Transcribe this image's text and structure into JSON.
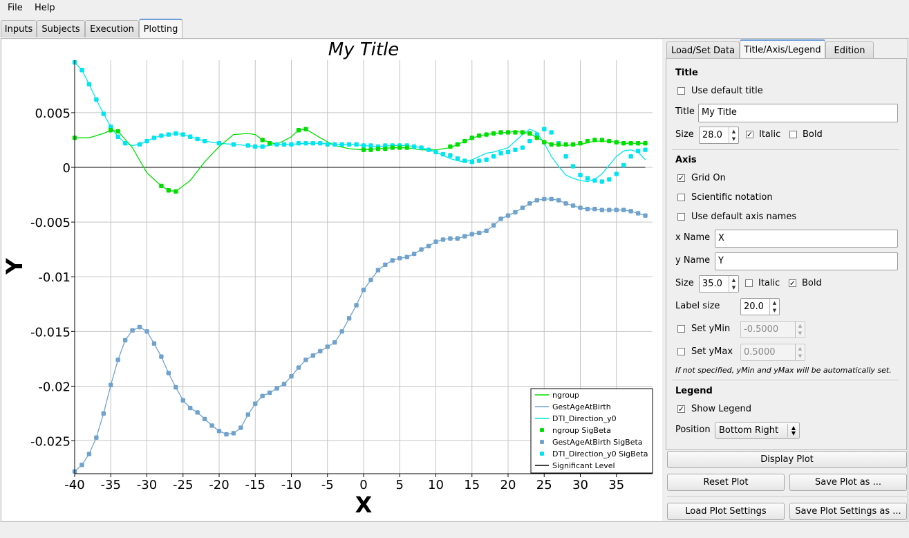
{
  "menu": {
    "file": "File",
    "help": "Help"
  },
  "main_tabs": [
    "Inputs",
    "Subjects",
    "Execution",
    "Plotting"
  ],
  "active_main_tab": "Plotting",
  "right_tabs": [
    "Load/Set Data",
    "Title/Axis/Legend",
    "Edition"
  ],
  "active_right_tab": "Title/Axis/Legend",
  "panel": {
    "title_section": "Title",
    "use_default_title": "Use default title",
    "use_default_title_checked": false,
    "title_label": "Title",
    "title_value": "My Title",
    "size_label": "Size",
    "title_size": "28.0",
    "italic_label": "Italic",
    "title_italic": true,
    "bold_label": "Bold",
    "title_bold": false,
    "axis_section": "Axis",
    "grid_on": "Grid On",
    "grid_on_checked": true,
    "scientific": "Scientific notation",
    "scientific_checked": false,
    "default_axis_names": "Use default axis names",
    "default_axis_names_checked": false,
    "x_name_label": "x Name",
    "x_name": "X",
    "y_name_label": "y Name",
    "y_name": "Y",
    "axis_size": "35.0",
    "axis_italic": false,
    "axis_bold": true,
    "label_size_label": "Label size",
    "label_size": "20.0",
    "set_ymin": "Set yMin",
    "ymin": "-0.5000",
    "set_ymax": "Set yMax",
    "ymax": "0.5000",
    "note": "If not specified, yMin and yMax will be automatically set.",
    "legend_section": "Legend",
    "show_legend": "Show Legend",
    "show_legend_checked": true,
    "position_label": "Position",
    "position_value": "Bottom Right"
  },
  "buttons": {
    "display_plot": "Display Plot",
    "reset_plot": "Reset Plot",
    "save_plot": "Save Plot as ...",
    "load_settings": "Load Plot Settings",
    "save_settings": "Save Plot Settings as ..."
  },
  "icons": {
    "check": "check-icon",
    "updown": "up-down-arrows-icon",
    "spin": "spin-arrows-icon"
  },
  "chart_data": {
    "type": "line",
    "title": "My Title",
    "xlabel": "X",
    "ylabel": "Y",
    "xlim": [
      -40,
      40
    ],
    "ylim": [
      -0.028,
      0.0098
    ],
    "x_ticks": [
      -40,
      -35,
      -30,
      -25,
      -20,
      -15,
      -10,
      -5,
      0,
      5,
      10,
      15,
      20,
      25,
      30,
      35
    ],
    "y_ticks": [
      0.005,
      0,
      -0.005,
      -0.01,
      -0.015,
      -0.02,
      -0.025
    ],
    "y_tick_labels": [
      "0.005",
      "0",
      "-0.005",
      "-0.01",
      "-0.015",
      "-0.02",
      "-0.025"
    ],
    "grid": true,
    "legend_position": "bottom-right",
    "colors": {
      "ngroup": "#00e000",
      "gest": "#6fa2cc",
      "dti": "#00e5f0",
      "sig": "#000000"
    },
    "significant_level": 0,
    "legend": [
      "ngroup",
      "GestAgeAtBirth",
      "DTI_Direction_y0",
      "ngroup SigBeta",
      "GestAgeAtBirth SigBeta",
      "DTI_Direction_y0 SigBeta",
      "Significant Level"
    ],
    "series": [
      {
        "name": "ngroup",
        "x": [
          -40,
          -38,
          -36,
          -35,
          -34,
          -32,
          -30,
          -28,
          -27,
          -26,
          -24,
          -22,
          -20,
          -18,
          -16,
          -15,
          -14,
          -12,
          -10,
          -9,
          -8,
          -6,
          -4,
          -2,
          0,
          2,
          4,
          6,
          8,
          10,
          12,
          14,
          16,
          18,
          20,
          21,
          22,
          23,
          24,
          26,
          28,
          30,
          32,
          34,
          36,
          39
        ],
        "y": [
          0.0027,
          0.0027,
          0.0031,
          0.0034,
          0.0033,
          0.0018,
          -0.0005,
          -0.0017,
          -0.0021,
          -0.0022,
          -0.0012,
          0.0005,
          0.0019,
          0.003,
          0.0031,
          0.003,
          0.0025,
          0.0021,
          0.0028,
          0.0034,
          0.0035,
          0.0027,
          0.002,
          0.0017,
          0.0016,
          0.0017,
          0.0018,
          0.0018,
          0.0016,
          0.0016,
          0.0018,
          0.0024,
          0.0029,
          0.0031,
          0.0032,
          0.0033,
          0.0032,
          0.0031,
          0.0027,
          0.0021,
          0.002,
          0.0021,
          0.0024,
          0.0024,
          0.0022,
          0.0022
        ]
      },
      {
        "name": "GestAgeAtBirth",
        "x": [
          -40,
          -39,
          -38,
          -37,
          -36,
          -35,
          -34,
          -33,
          -32,
          -31,
          -30,
          -29,
          -28,
          -27,
          -26,
          -25,
          -24,
          -23,
          -22,
          -21,
          -20,
          -19,
          -18,
          -17,
          -16,
          -15,
          -14,
          -13,
          -12,
          -11,
          -10,
          -9,
          -8,
          -7,
          -6,
          -5,
          -4,
          -3,
          -2,
          -1,
          0,
          1,
          2,
          3,
          4,
          5,
          6,
          7,
          8,
          9,
          10,
          11,
          12,
          13,
          14,
          15,
          16,
          17,
          18,
          19,
          20,
          21,
          22,
          23,
          24,
          25,
          26,
          27,
          28,
          29,
          30,
          31,
          32,
          33,
          34,
          35,
          36,
          37,
          38,
          39
        ],
        "y": [
          -0.0278,
          -0.0272,
          -0.0262,
          -0.0247,
          -0.0225,
          -0.0199,
          -0.0176,
          -0.0158,
          -0.0149,
          -0.0146,
          -0.015,
          -0.0161,
          -0.0173,
          -0.0188,
          -0.0201,
          -0.0213,
          -0.022,
          -0.0224,
          -0.023,
          -0.0236,
          -0.0241,
          -0.0244,
          -0.0243,
          -0.0238,
          -0.0226,
          -0.0216,
          -0.0209,
          -0.0206,
          -0.0202,
          -0.0198,
          -0.0191,
          -0.0183,
          -0.0176,
          -0.0172,
          -0.0168,
          -0.0164,
          -0.016,
          -0.015,
          -0.0138,
          -0.0126,
          -0.0112,
          -0.0103,
          -0.0094,
          -0.0089,
          -0.0085,
          -0.0083,
          -0.0082,
          -0.0079,
          -0.0075,
          -0.0072,
          -0.0068,
          -0.0066,
          -0.0065,
          -0.0065,
          -0.0063,
          -0.0061,
          -0.006,
          -0.0058,
          -0.0053,
          -0.0047,
          -0.0044,
          -0.0041,
          -0.0037,
          -0.0033,
          -0.003,
          -0.0029,
          -0.0029,
          -0.003,
          -0.0033,
          -0.0035,
          -0.0037,
          -0.0038,
          -0.0038,
          -0.0039,
          -0.0039,
          -0.0039,
          -0.0039,
          -0.004,
          -0.0042,
          -0.0044
        ]
      },
      {
        "name": "DTI_Direction_y0",
        "x": [
          -40,
          -39,
          -38,
          -37,
          -36,
          -35,
          -34,
          -33,
          -32,
          -31,
          -30,
          -29,
          -28,
          -27,
          -26,
          -25,
          -24,
          -23,
          -22,
          -20,
          -18,
          -16,
          -15,
          -14,
          -12,
          -10,
          -8,
          -6,
          -4,
          -2,
          0,
          2,
          4,
          6,
          8,
          10,
          11,
          12,
          13,
          14,
          15,
          16,
          17,
          18,
          19,
          20,
          21,
          22,
          23,
          24,
          25,
          26,
          27,
          28,
          29,
          30,
          31,
          32,
          33,
          34,
          35,
          36,
          37,
          38,
          39
        ],
        "y": [
          0.0096,
          0.0089,
          0.0076,
          0.0062,
          0.0049,
          0.0037,
          0.0028,
          0.0022,
          0.002,
          0.0021,
          0.0024,
          0.0027,
          0.0029,
          0.003,
          0.0031,
          0.003,
          0.0028,
          0.0026,
          0.0024,
          0.0022,
          0.0021,
          0.002,
          0.0019,
          0.0019,
          0.0021,
          0.0021,
          0.0022,
          0.0022,
          0.0021,
          0.0021,
          0.002,
          0.0019,
          0.002,
          0.002,
          0.0018,
          0.0014,
          0.0011,
          0.0008,
          0.0006,
          0.0005,
          0.0007,
          0.001,
          0.0013,
          0.0014,
          0.0016,
          0.0018,
          0.0024,
          0.003,
          0.0035,
          0.0032,
          0.0022,
          0.001,
          0.0001,
          -0.0007,
          -0.001,
          -0.0012,
          -0.0013,
          -0.0011,
          -0.0006,
          0.0002,
          0.001,
          0.0015,
          0.0016,
          0.0014,
          0.0007
        ]
      },
      {
        "name": "Significant Level",
        "x": [
          -40,
          39
        ],
        "y": [
          0,
          0
        ]
      }
    ],
    "sig_points": {
      "ngroup": {
        "x": [
          -40,
          -35,
          -34,
          -28,
          -27,
          -26,
          -14,
          -13,
          -9,
          -8,
          0,
          1,
          2,
          3,
          4,
          5,
          6,
          12,
          13,
          14,
          15,
          16,
          17,
          18,
          19,
          20,
          21,
          22,
          23,
          24,
          25,
          26,
          27,
          28,
          29,
          30,
          31,
          32,
          33,
          34,
          35,
          36,
          37,
          38,
          39
        ],
        "y": [
          0.0027,
          0.0034,
          0.0033,
          -0.0017,
          -0.0021,
          -0.0022,
          0.0025,
          0.0022,
          0.0034,
          0.0035,
          0.0016,
          0.0016,
          0.0017,
          0.0017,
          0.0018,
          0.0018,
          0.0018,
          0.0019,
          0.0021,
          0.0024,
          0.0027,
          0.0029,
          0.003,
          0.0031,
          0.0032,
          0.0032,
          0.0032,
          0.0032,
          0.0031,
          0.0027,
          0.0023,
          0.0021,
          0.0021,
          0.0021,
          0.0021,
          0.0022,
          0.0024,
          0.0025,
          0.0025,
          0.0024,
          0.0023,
          0.0022,
          0.0022,
          0.0022,
          0.0022
        ]
      },
      "gest": {
        "x": [
          -40,
          -39,
          -38,
          -37,
          -36,
          -35,
          -34,
          -33,
          -32,
          -31,
          -30,
          -29,
          -28,
          -27,
          -26,
          -25,
          -24,
          -23,
          -22,
          -21,
          -20,
          -19,
          -18,
          -17,
          -16,
          -15,
          -14,
          -13,
          -12,
          -11,
          -10,
          -9,
          -8,
          -7,
          -6,
          -5,
          -4,
          -3,
          -2,
          -1,
          0,
          1,
          2,
          3,
          4,
          5,
          6,
          7,
          8,
          9,
          10,
          11,
          12,
          13,
          14,
          15,
          16,
          17,
          18,
          19,
          20,
          21,
          22,
          23,
          24,
          25,
          26,
          27,
          28,
          29,
          30,
          31,
          32,
          33,
          34,
          35,
          36,
          37,
          38,
          39
        ],
        "y": [
          -0.0278,
          -0.0272,
          -0.0262,
          -0.0247,
          -0.0225,
          -0.0199,
          -0.0176,
          -0.0158,
          -0.0149,
          -0.0146,
          -0.015,
          -0.0161,
          -0.0173,
          -0.0188,
          -0.0201,
          -0.0213,
          -0.022,
          -0.0224,
          -0.023,
          -0.0236,
          -0.0241,
          -0.0244,
          -0.0243,
          -0.0238,
          -0.0226,
          -0.0216,
          -0.0209,
          -0.0206,
          -0.0202,
          -0.0198,
          -0.0191,
          -0.0183,
          -0.0176,
          -0.0172,
          -0.0168,
          -0.0164,
          -0.016,
          -0.015,
          -0.0138,
          -0.0126,
          -0.0112,
          -0.0103,
          -0.0094,
          -0.0089,
          -0.0085,
          -0.0083,
          -0.0082,
          -0.0079,
          -0.0075,
          -0.0072,
          -0.0068,
          -0.0066,
          -0.0065,
          -0.0065,
          -0.0063,
          -0.0061,
          -0.006,
          -0.0058,
          -0.0053,
          -0.0047,
          -0.0044,
          -0.0041,
          -0.0037,
          -0.0033,
          -0.003,
          -0.0029,
          -0.0029,
          -0.003,
          -0.0033,
          -0.0035,
          -0.0037,
          -0.0038,
          -0.0038,
          -0.0039,
          -0.0039,
          -0.0039,
          -0.0039,
          -0.004,
          -0.0042,
          -0.0044
        ]
      },
      "dti": {
        "x": [
          -40,
          -39,
          -38,
          -37,
          -36,
          -35,
          -34,
          -33,
          -31,
          -30,
          -29,
          -28,
          -27,
          -26,
          -25,
          -24,
          -23,
          -22,
          -20,
          -18,
          -16,
          -15,
          -14,
          -12,
          -11,
          -10,
          -9,
          -8,
          -7,
          -6,
          -5,
          -4,
          -3,
          -2,
          -1,
          0,
          1,
          2,
          3,
          4,
          5,
          6,
          7,
          8,
          9,
          10,
          11,
          12,
          13,
          14,
          15,
          16,
          17,
          18,
          19,
          20,
          21,
          22,
          23,
          24,
          25,
          26,
          27,
          28,
          29,
          30,
          31,
          32,
          33,
          34,
          35,
          36,
          37,
          38,
          39
        ],
        "y": [
          0.0096,
          0.0089,
          0.0076,
          0.0062,
          0.0049,
          0.0037,
          0.0028,
          0.0022,
          0.0021,
          0.0024,
          0.0027,
          0.0029,
          0.003,
          0.0031,
          0.003,
          0.0028,
          0.0026,
          0.0024,
          0.0022,
          0.0021,
          0.002,
          0.0019,
          0.0019,
          0.0021,
          0.0021,
          0.0021,
          0.0022,
          0.0022,
          0.0022,
          0.0022,
          0.0021,
          0.0021,
          0.0021,
          0.0021,
          0.0021,
          0.002,
          0.002,
          0.0019,
          0.002,
          0.002,
          0.002,
          0.002,
          0.0019,
          0.0018,
          0.0016,
          0.0014,
          0.0012,
          0.0011,
          0.0008,
          0.0006,
          0.0005,
          0.0006,
          0.0007,
          0.001,
          0.0013,
          0.0014,
          0.0016,
          0.0018,
          0.0024,
          0.003,
          0.0035,
          0.0032,
          0.0022,
          0.001,
          0.0001,
          -0.0007,
          -0.001,
          -0.0012,
          -0.0013,
          -0.0011,
          -0.0006,
          0.0002,
          0.001,
          0.0015,
          0.0016,
          0.0014,
          0.0007
        ]
      }
    }
  }
}
